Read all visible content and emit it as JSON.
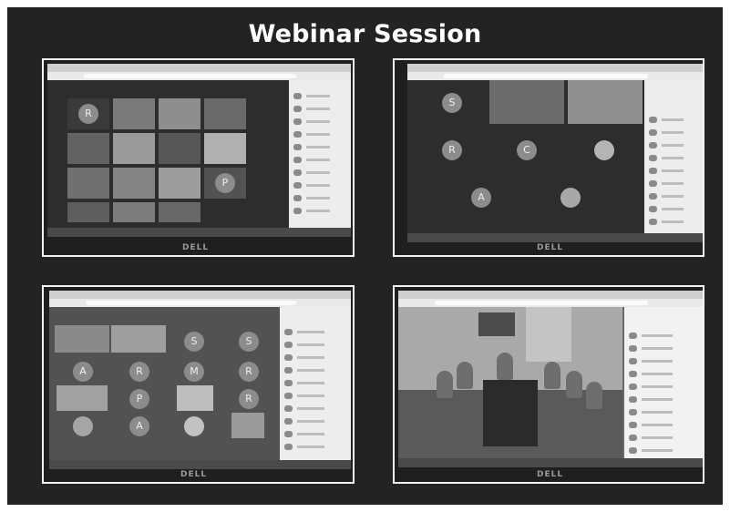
{
  "title": "Webinar Session",
  "photos": [
    {
      "name": "screenshot-1",
      "monitor_brand": "DELL"
    },
    {
      "name": "screenshot-2",
      "monitor_brand": "DELL"
    },
    {
      "name": "screenshot-3",
      "monitor_brand": "DELL"
    },
    {
      "name": "screenshot-4",
      "monitor_brand": "DELL"
    }
  ],
  "avatars": {
    "p1": [
      "R",
      "P"
    ],
    "p2": [
      "S",
      "R",
      "C",
      "A"
    ],
    "p3": [
      "S",
      "S",
      "A",
      "R",
      "M",
      "R",
      "P",
      "R",
      "A"
    ]
  }
}
